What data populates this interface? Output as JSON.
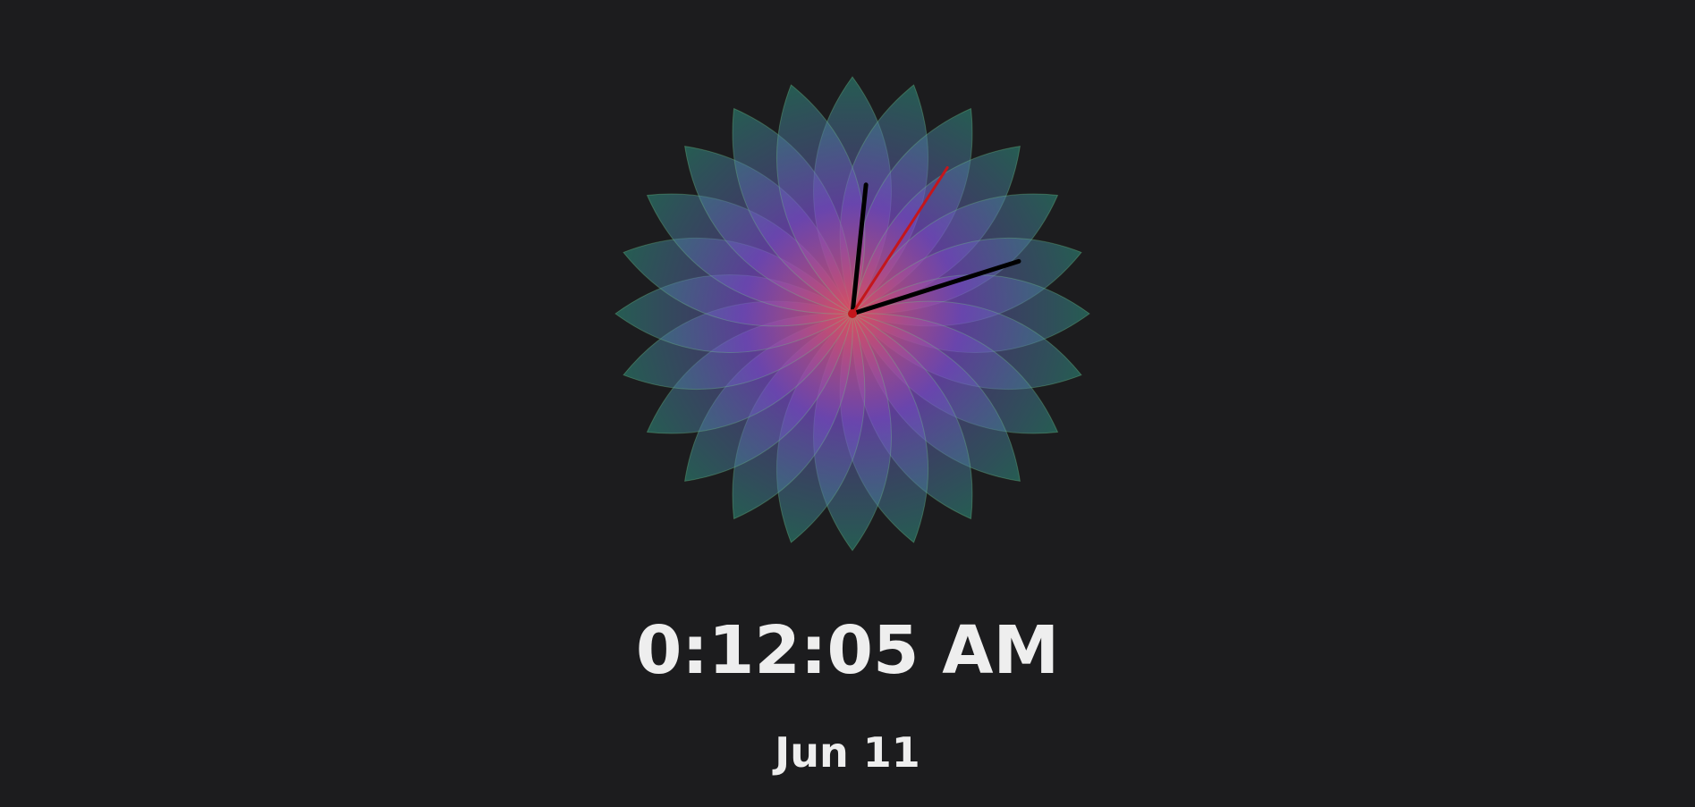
{
  "clock": {
    "time_text": "0:12:05 AM",
    "date_text": "Jun 11",
    "hour": 0,
    "minute": 12,
    "second": 5
  },
  "colors": {
    "background": "#1c1c1e",
    "text": "#eeeeee",
    "petal_outer": "#2f9d86",
    "petal_mid": "#7b4fd0",
    "petal_center": "#e0505f",
    "hour_minute_hands": "#000000",
    "second_hand": "#c4161c"
  }
}
